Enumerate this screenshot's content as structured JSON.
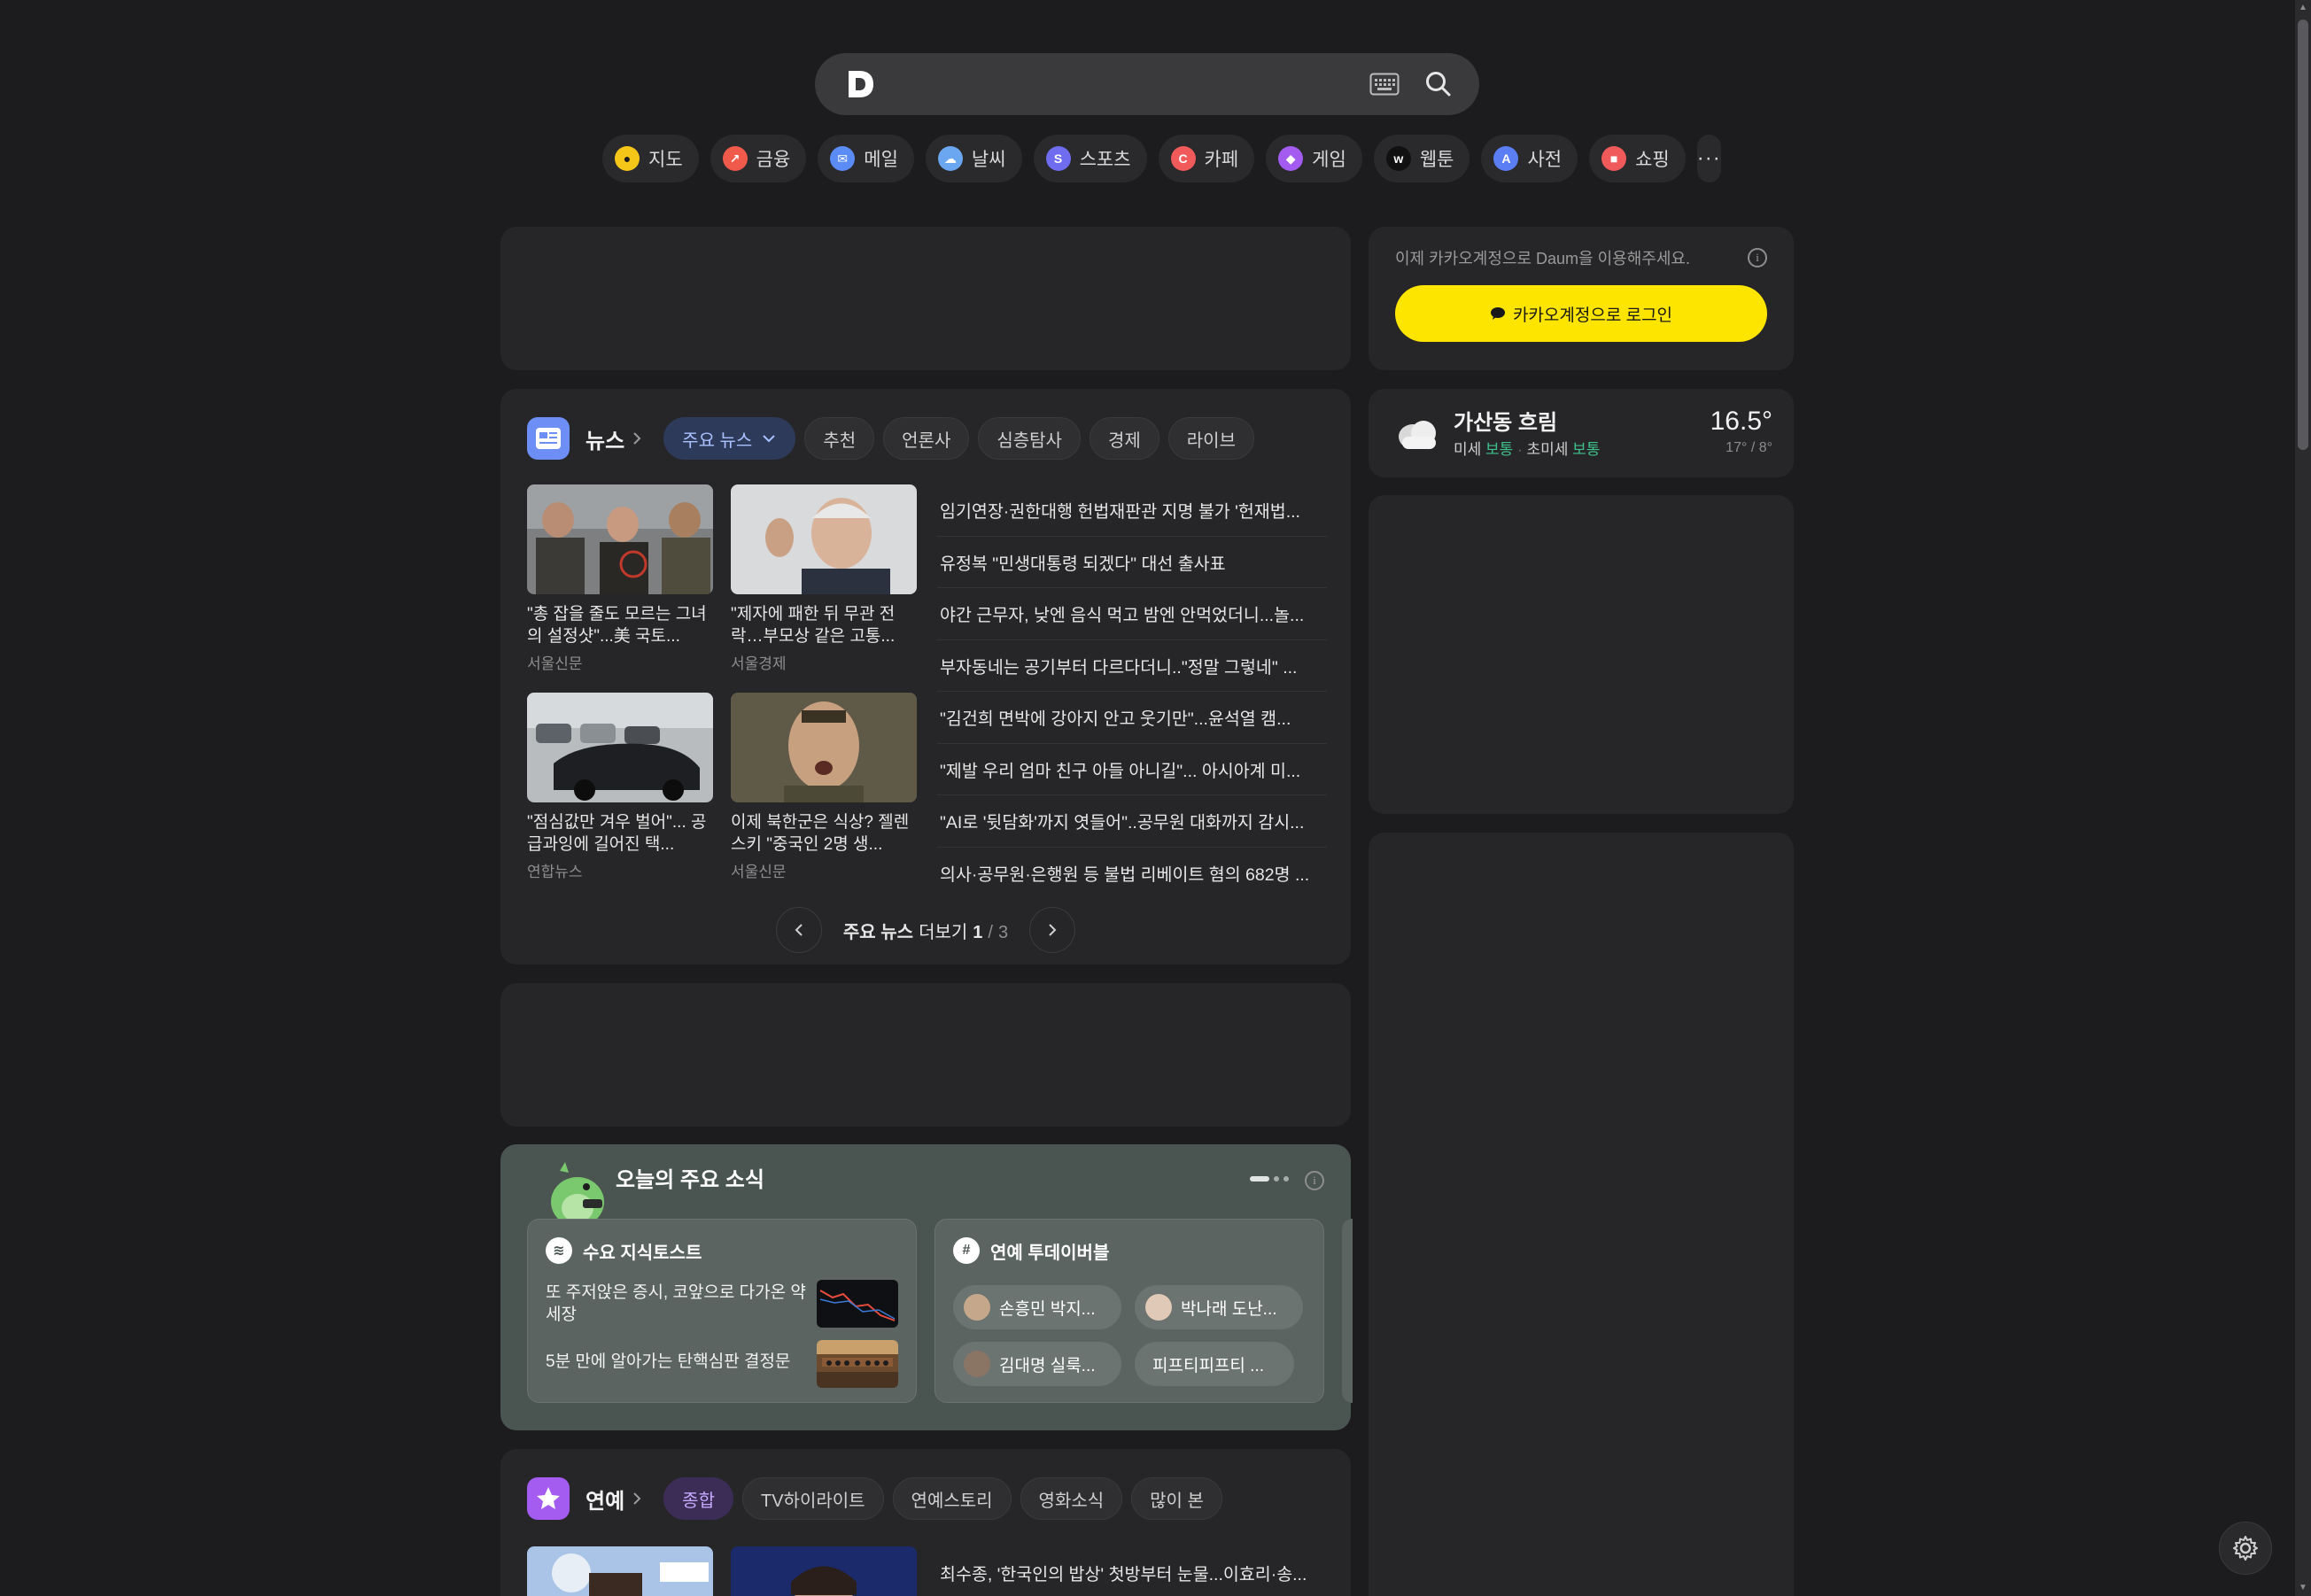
{
  "search": {
    "logo": "D",
    "placeholder": ""
  },
  "services": [
    {
      "label": "지도",
      "icon": "map-pin-icon",
      "color": "#f5c518"
    },
    {
      "label": "금융",
      "icon": "finance-icon",
      "color": "#ef5a4a"
    },
    {
      "label": "메일",
      "icon": "mail-icon",
      "color": "#5b8cf5"
    },
    {
      "label": "날씨",
      "icon": "weather-icon",
      "color": "#6aa7f0"
    },
    {
      "label": "스포츠",
      "icon": "sports-icon",
      "color": "#6f6cf0"
    },
    {
      "label": "카페",
      "icon": "cafe-icon",
      "color": "#f05a5a"
    },
    {
      "label": "게임",
      "icon": "game-icon",
      "color": "#a45cf0"
    },
    {
      "label": "웹툰",
      "icon": "webtoon-icon",
      "color": "#111111"
    },
    {
      "label": "사전",
      "icon": "dictionary-icon",
      "color": "#5b7ef5"
    },
    {
      "label": "쇼핑",
      "icon": "shopping-icon",
      "color": "#f05a5a"
    }
  ],
  "news": {
    "title": "뉴스",
    "tabs": [
      {
        "label": "주요 뉴스",
        "active": true
      },
      {
        "label": "추천"
      },
      {
        "label": "언론사"
      },
      {
        "label": "심층탐사"
      },
      {
        "label": "경제"
      },
      {
        "label": "라이브"
      }
    ],
    "cards": [
      {
        "title": "\"총 잡을 줄도 모르는 그녀의 설정샷\"...美 국토...",
        "source": "서울신문"
      },
      {
        "title": "\"제자에 패한 뒤 무관 전락…부모상 같은 고통...",
        "source": "서울경제"
      },
      {
        "title": "\"점심값만 겨우 벌어\"... 공급과잉에 길어진 택...",
        "source": "연합뉴스"
      },
      {
        "title": "이제 북한군은 식상? 젤렌스키 \"중국인 2명 생...",
        "source": "서울신문"
      }
    ],
    "headlines": [
      "임기연장·권한대행 헌법재판관 지명 불가 '헌재법...",
      "유정복 \"민생대통령 되겠다\" 대선 출사표",
      "야간 근무자, 낮엔 음식 먹고 밤엔 안먹었더니...놀...",
      "부자동네는 공기부터 다르다더니..\"정말 그렇네\" ...",
      "\"김건희 면박에 강아지 안고 웃기만\"...윤석열 캠...",
      "\"제발 우리 엄마 친구 아들 아니길\"... 아시아계 미...",
      "\"AI로 '뒷담화'까지 엿들어\"..공무원 대화까지 감시...",
      "의사·공무원·은행원 등 불법 리베이트 혐의 682명 ..."
    ],
    "pager": {
      "label": "주요 뉴스",
      "more": "더보기",
      "current": "1",
      "sep": "/",
      "total": "3"
    }
  },
  "today": {
    "title": "오늘의 주요 소식",
    "card1": {
      "title": "수요 지식토스트",
      "items": [
        "또 주저앉은 증시, 코앞으로 다가온 약세장",
        "5분 만에 알아가는 탄핵심판 결정문"
      ]
    },
    "card2": {
      "title": "연예 투데이버블",
      "chips": [
        "손흥민 박지...",
        "박나래 도난...",
        "김대명 실룩...",
        "피프티피프티 ..."
      ]
    }
  },
  "entertainment": {
    "title": "연예",
    "tabs": [
      {
        "label": "종합",
        "active": true
      },
      {
        "label": "TV하이라이트"
      },
      {
        "label": "연예스토리"
      },
      {
        "label": "영화소식"
      },
      {
        "label": "많이 본"
      }
    ],
    "headline": "최수종, '한국인의 밥상' 첫방부터 눈물...이효리·송..."
  },
  "login": {
    "notice": "이제 카카오계정으로 Daum을 이용해주세요.",
    "button": "카카오계정으로 로그인",
    "button_color": "#fee500"
  },
  "weather": {
    "location": "가산동 흐림",
    "pm10_label": "미세",
    "pm10_value": "보통",
    "pm25_label": "초미세",
    "pm25_value": "보통",
    "temp": "16.5°",
    "range": "17° / 8°"
  }
}
